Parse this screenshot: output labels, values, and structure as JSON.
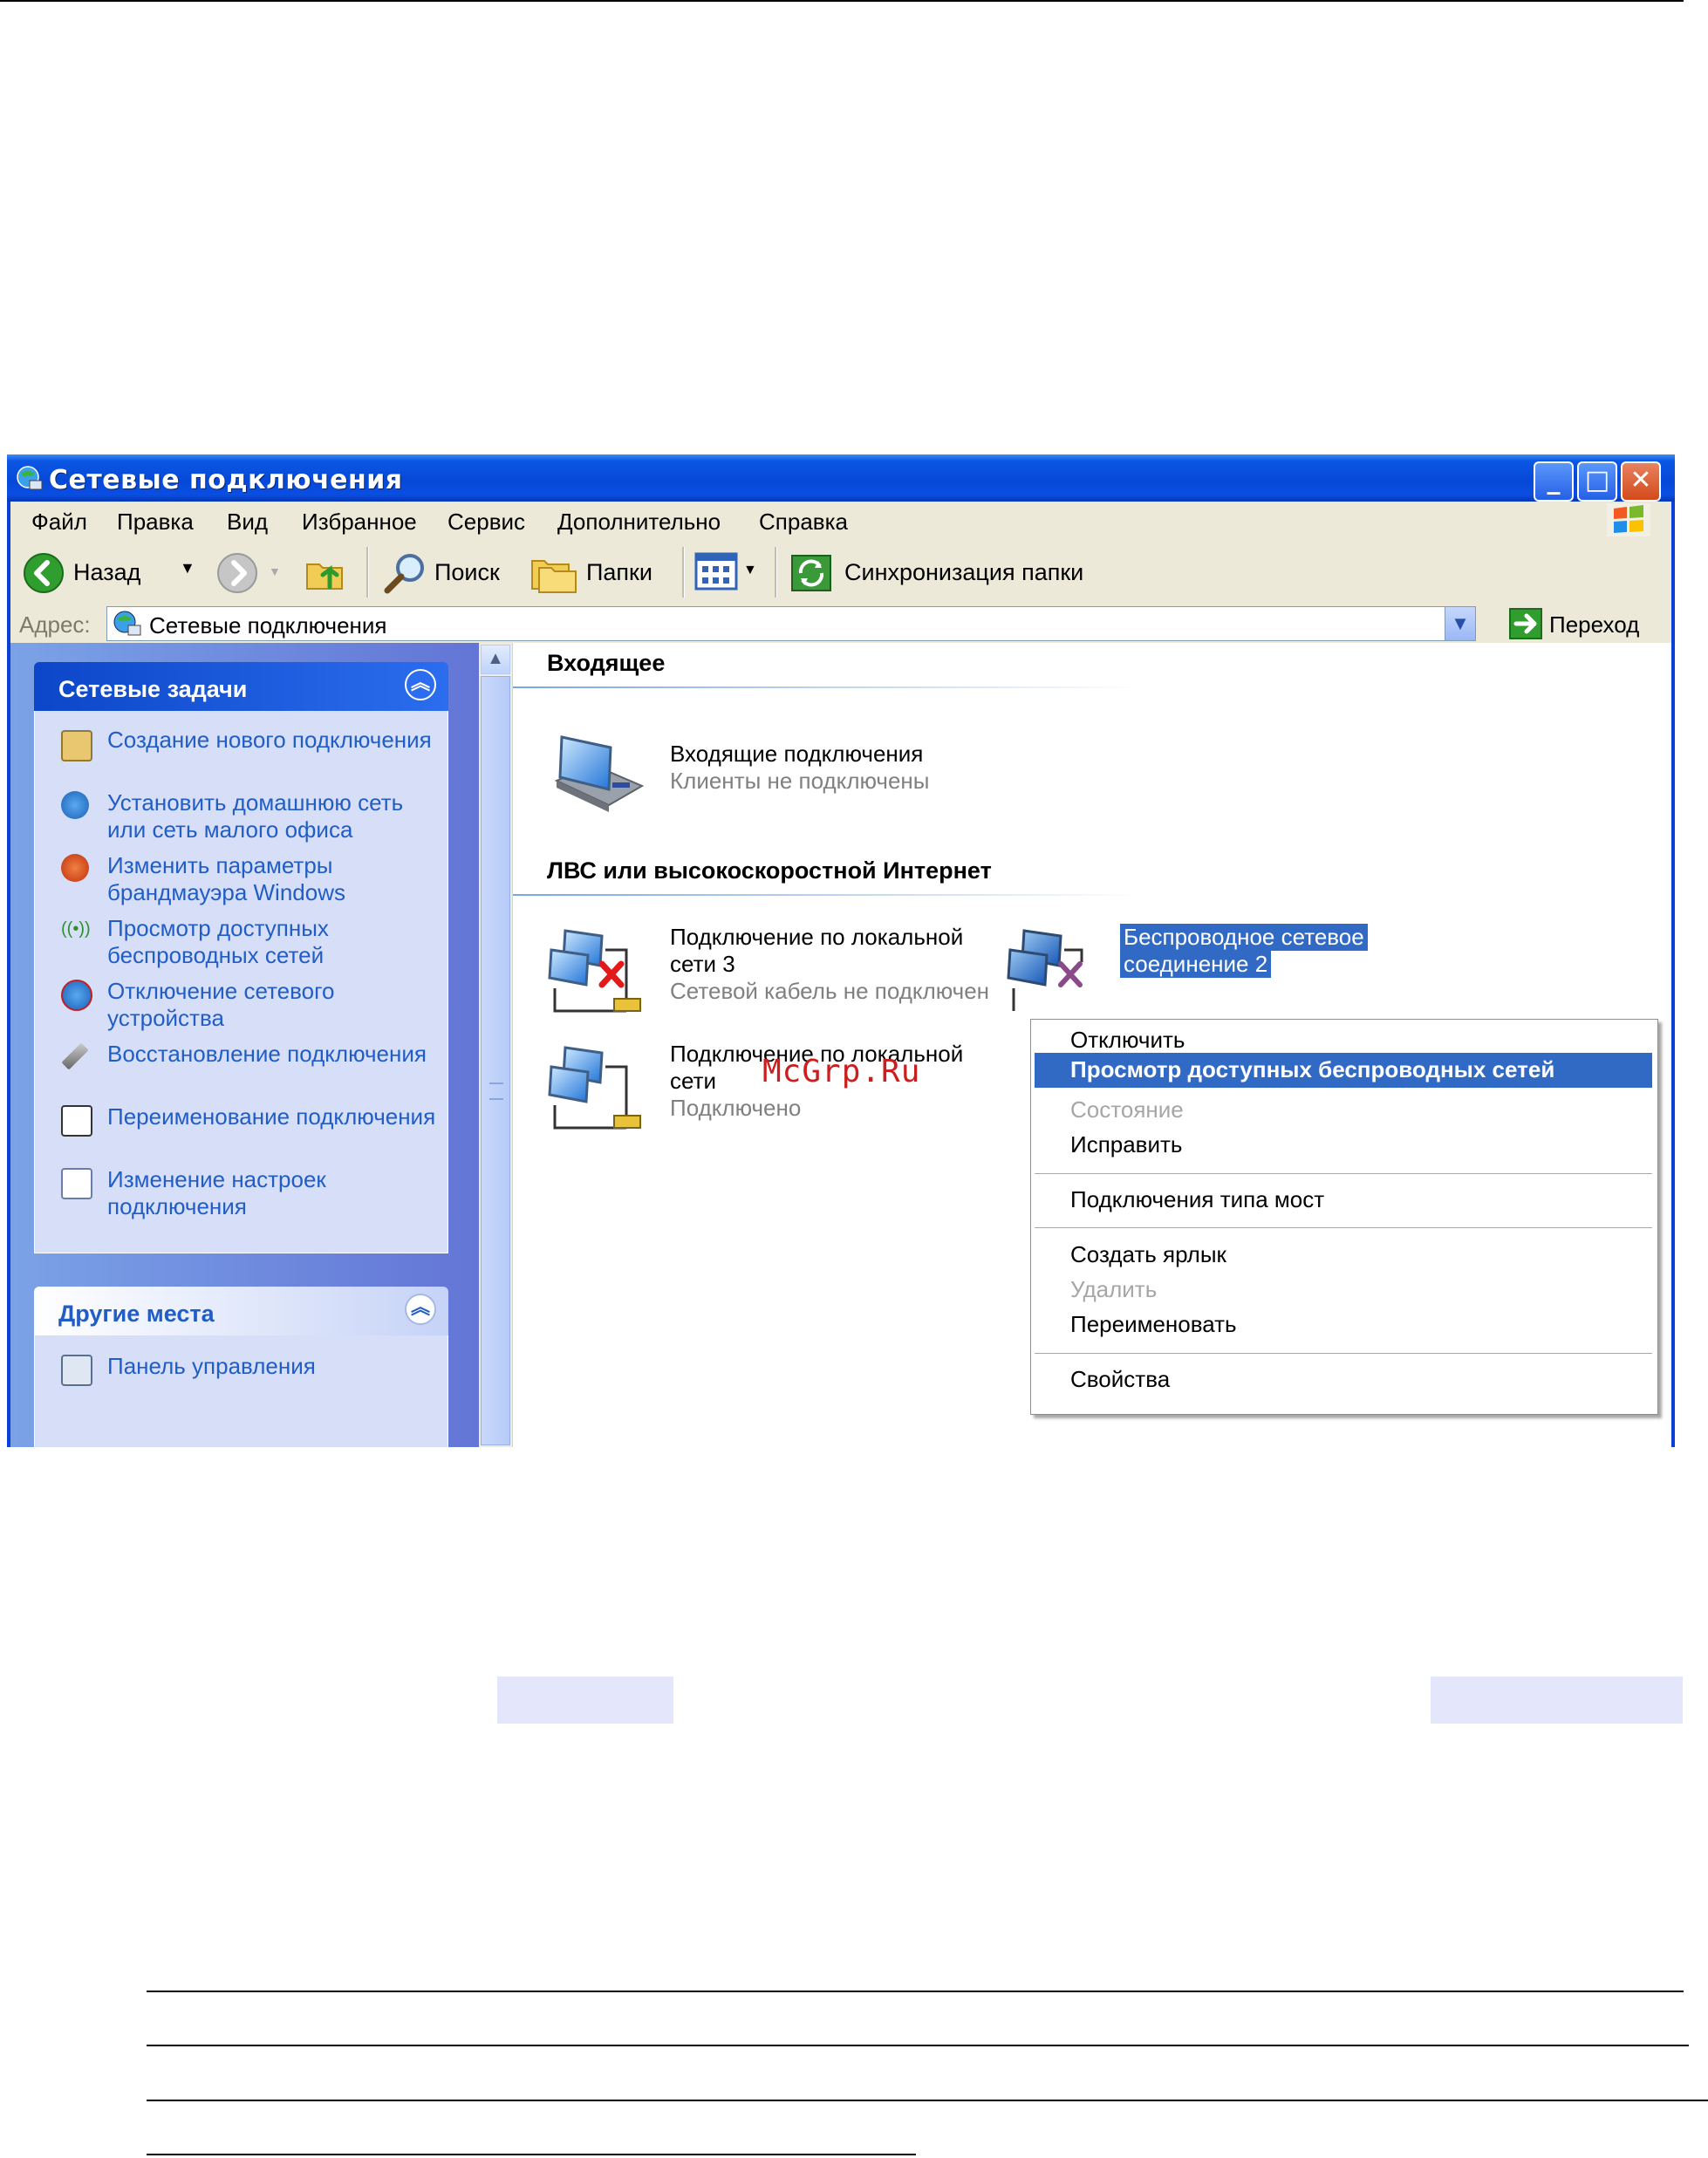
{
  "window": {
    "title": "Сетевые подключения",
    "buttons": {
      "minimize": "_",
      "maximize": "□",
      "close": "✕"
    }
  },
  "menubar": [
    "Файл",
    "Правка",
    "Вид",
    "Избранное",
    "Сервис",
    "Дополнительно",
    "Справка"
  ],
  "toolbar": {
    "back_label": "Назад",
    "search_label": "Поиск",
    "folders_label": "Папки",
    "sync_label": "Синхронизация папки"
  },
  "address": {
    "label": "Адрес:",
    "value": "Сетевые подключения",
    "go_label": "Переход"
  },
  "sidebar": {
    "network_tasks": {
      "title": "Сетевые задачи",
      "items": [
        {
          "label": "Создание нового подключения",
          "icon": "new-connection-icon"
        },
        {
          "label": "Установить домашнюю сеть или сеть малого офиса",
          "icon": "home-network-icon"
        },
        {
          "label": "Изменить параметры брандмауэра Windows",
          "icon": "firewall-icon"
        },
        {
          "label": "Просмотр доступных беспроводных сетей",
          "icon": "wireless-icon"
        },
        {
          "label": "Отключение сетевого устройства",
          "icon": "disable-device-icon"
        },
        {
          "label": "Восстановление подключения",
          "icon": "repair-icon"
        },
        {
          "label": "Переименование подключения",
          "icon": "rename-icon"
        },
        {
          "label": "Изменение настроек подключения",
          "icon": "settings-icon"
        }
      ]
    },
    "other_places": {
      "title": "Другие места",
      "items": [
        {
          "label": "Панель управления",
          "icon": "control-panel-icon"
        }
      ]
    }
  },
  "content": {
    "groups": [
      {
        "title": "Входящее",
        "items": [
          {
            "name": "Входящие подключения",
            "status": "Клиенты не подключены"
          }
        ]
      },
      {
        "title": "ЛВС или высокоскоростной Интернет",
        "items": [
          {
            "name_line1": "Подключение по локальной",
            "name_line2": "сети 3",
            "status": "Сетевой кабель не подключен"
          },
          {
            "name_line1": "Подключение по локальной",
            "name_line2": "сети",
            "status": "Подключено"
          },
          {
            "name_line1": "Беспроводное сетевое",
            "name_line2": "соединение 2",
            "status": ""
          }
        ]
      }
    ]
  },
  "context_menu": [
    {
      "label": "Отключить",
      "disabled": false
    },
    {
      "label": "Просмотр доступных беспроводных сетей",
      "highlighted": true
    },
    {
      "label": "Состояние",
      "disabled": true
    },
    {
      "label": "Исправить",
      "disabled": false
    },
    {
      "label": "Подключения типа мост",
      "disabled": false
    },
    {
      "label": "Создать ярлык",
      "disabled": false
    },
    {
      "label": "Удалить",
      "disabled": true
    },
    {
      "label": "Переименовать",
      "disabled": false
    },
    {
      "label": "Свойства",
      "disabled": false
    }
  ],
  "watermark": "McGrp.Ru",
  "colors": {
    "title_bar": "#0a4ee2",
    "menu_highlight": "#316ac5",
    "link": "#215dc6",
    "chrome": "#ece9d8"
  }
}
